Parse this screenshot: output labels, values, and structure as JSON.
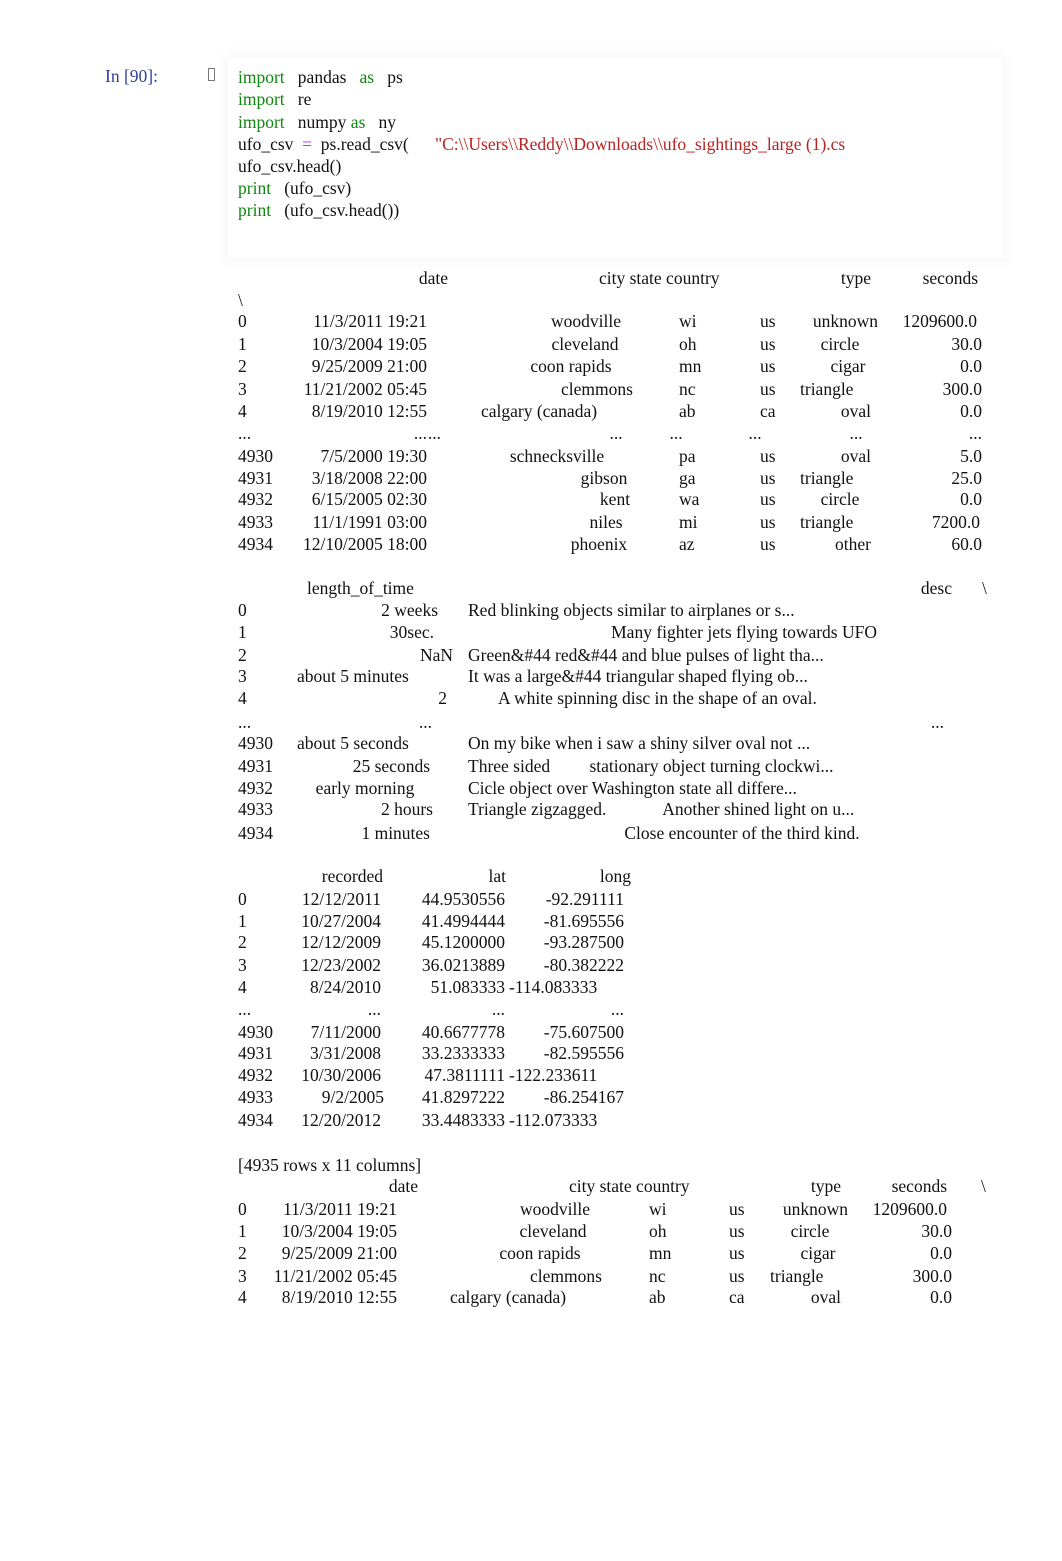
{
  "cell": {
    "prompt": "In [90]:",
    "icon": "cell-collapse-icon",
    "code": [
      [
        {
          "c": "kw",
          "t": "import"
        },
        {
          "c": "",
          "t": "   pandas   "
        },
        {
          "c": "kw",
          "t": "as"
        },
        {
          "c": "",
          "t": "   ps"
        }
      ],
      [
        {
          "c": "kw",
          "t": "import"
        },
        {
          "c": "",
          "t": "   re"
        }
      ],
      [
        {
          "c": "kw",
          "t": "import"
        },
        {
          "c": "",
          "t": "   numpy "
        },
        {
          "c": "kw",
          "t": "as"
        },
        {
          "c": "",
          "t": "   ny"
        }
      ],
      [
        {
          "c": "",
          "t": "ufo_csv  "
        },
        {
          "c": "op",
          "t": "="
        },
        {
          "c": "",
          "t": "  ps.read_csv(      "
        },
        {
          "c": "str",
          "t": "\"C:\\\\Users\\\\Reddy\\\\Downloads\\\\ufo_sightings_large (1).cs"
        }
      ],
      [
        {
          "c": "",
          "t": "ufo_csv.head()"
        }
      ],
      [
        {
          "c": "kw",
          "t": "print"
        },
        {
          "c": "",
          "t": "   (ufo_csv)"
        }
      ],
      [
        {
          "c": "kw",
          "t": "print"
        },
        {
          "c": "",
          "t": "   (ufo_csv.head())"
        }
      ]
    ]
  },
  "output": {
    "block1": {
      "headers": [
        "date",
        "city state country",
        "type",
        "seconds"
      ],
      "continuation": "\\",
      "rows": [
        {
          "idx": "0",
          "date": "11/3/2011 19:21",
          "city": "woodville",
          "state": "wi",
          "country": "us",
          "type": "unknown",
          "seconds": "1209600.0"
        },
        {
          "idx": "1",
          "date": "10/3/2004 19:05",
          "city": "cleveland",
          "state": "oh",
          "country": "us",
          "type": "circle",
          "seconds": "30.0"
        },
        {
          "idx": "2",
          "date": "9/25/2009 21:00",
          "city": "coon rapids",
          "state": "mn",
          "country": "us",
          "type": "cigar",
          "seconds": "0.0"
        },
        {
          "idx": "3",
          "date": "11/21/2002 05:45",
          "city": "clemmons",
          "state": "nc",
          "country": "us",
          "type": "triangle",
          "seconds": "300.0"
        },
        {
          "idx": "4",
          "date": "8/19/2010 12:55",
          "city": "calgary (canada)",
          "state": "ab",
          "country": "ca",
          "type": "oval",
          "seconds": "0.0"
        },
        {
          "idx": "...",
          "date": "...",
          "city": "...",
          "state": "...",
          "country": "...",
          "type": "...",
          "seconds": "..."
        },
        {
          "idx": "4930",
          "date": "7/5/2000 19:30",
          "city": "schnecksville",
          "state": "pa",
          "country": "us",
          "type": "oval",
          "seconds": "5.0"
        },
        {
          "idx": "4931",
          "date": "3/18/2008 22:00",
          "city": "gibson",
          "state": "ga",
          "country": "us",
          "type": "triangle",
          "seconds": "25.0"
        },
        {
          "idx": "4932",
          "date": "6/15/2005 02:30",
          "city": "kent",
          "state": "wa",
          "country": "us",
          "type": "circle",
          "seconds": "0.0"
        },
        {
          "idx": "4933",
          "date": "11/1/1991 03:00",
          "city": "niles",
          "state": "mi",
          "country": "us",
          "type": "triangle",
          "seconds": "7200.0"
        },
        {
          "idx": "4934",
          "date": "12/10/2005 18:00",
          "city": "phoenix",
          "state": "az",
          "country": "us",
          "type": "other",
          "seconds": "60.0"
        }
      ]
    },
    "block2": {
      "headers": [
        "length_of_time",
        "desc"
      ],
      "continuation": "\\",
      "rows": [
        {
          "idx": "0",
          "length": "2 weeks",
          "desc": "Red blinking objects similar to airplanes or s..."
        },
        {
          "idx": "1",
          "length": "30sec.",
          "desc": "Many fighter jets flying towards UFO"
        },
        {
          "idx": "2",
          "length": "NaN",
          "desc": "Green&#44 red&#44 and blue pulses of light tha..."
        },
        {
          "idx": "3",
          "length": "about 5 minutes",
          "desc": "It was a large&#44 triangular shaped flying ob..."
        },
        {
          "idx": "4",
          "length": "2",
          "desc": "A white spinning disc in the shape of an oval."
        },
        {
          "idx": "...",
          "length": "...",
          "desc": "..."
        },
        {
          "idx": "4930",
          "length": "about 5 seconds",
          "desc": "On my bike when i saw a shiny silver oval not ..."
        },
        {
          "idx": "4931",
          "length": "25 seconds",
          "desc": "Three sided         stationary object turning clockwi..."
        },
        {
          "idx": "4932",
          "length": "early morning",
          "desc": "Cicle object over Washington state all differe..."
        },
        {
          "idx": "4933",
          "length": "2 hours",
          "desc": "Triangle zigzagged.             Another shined light on u..."
        },
        {
          "idx": "4934",
          "length": "1 minutes",
          "desc": "Close encounter of the third kind."
        }
      ]
    },
    "block3": {
      "headers": [
        "recorded",
        "lat",
        "long"
      ],
      "rows": [
        {
          "idx": "0",
          "recorded": "12/12/2011",
          "lat": "44.9530556",
          "long": "-92.291111"
        },
        {
          "idx": "1",
          "recorded": "10/27/2004",
          "lat": "41.4994444",
          "long": "-81.695556"
        },
        {
          "idx": "2",
          "recorded": "12/12/2009",
          "lat": "45.1200000",
          "long": "-93.287500"
        },
        {
          "idx": "3",
          "recorded": "12/23/2002",
          "lat": "36.0213889",
          "long": "-80.382222"
        },
        {
          "idx": "4",
          "recorded": "8/24/2010",
          "lat": "51.083333",
          "long": "-114.083333"
        },
        {
          "idx": "...",
          "recorded": "...",
          "lat": "...",
          "long": "..."
        },
        {
          "idx": "4930",
          "recorded": "7/11/2000",
          "lat": "40.6677778",
          "long": "-75.607500"
        },
        {
          "idx": "4931",
          "recorded": "3/31/2008",
          "lat": "33.2333333",
          "long": "-82.595556"
        },
        {
          "idx": "4932",
          "recorded": "10/30/2006",
          "lat": "47.3811111",
          "long": "-122.233611"
        },
        {
          "idx": "4933",
          "recorded": "9/2/2005",
          "lat": "41.8297222",
          "long": "-86.254167"
        },
        {
          "idx": "4934",
          "recorded": "12/20/2012",
          "lat": "33.4483333",
          "long": "-112.073333"
        }
      ]
    },
    "summary": "[4935 rows x 11 columns]",
    "block4": {
      "headers": [
        "date",
        "city state country",
        "type",
        "seconds"
      ],
      "continuation": "\\",
      "rows": [
        {
          "idx": "0",
          "date": "11/3/2011 19:21",
          "city": "woodville",
          "state": "wi",
          "country": "us",
          "type": "unknown",
          "seconds": "1209600.0"
        },
        {
          "idx": "1",
          "date": "10/3/2004 19:05",
          "city": "cleveland",
          "state": "oh",
          "country": "us",
          "type": "circle",
          "seconds": "30.0"
        },
        {
          "idx": "2",
          "date": "9/25/2009 21:00",
          "city": "coon rapids",
          "state": "mn",
          "country": "us",
          "type": "cigar",
          "seconds": "0.0"
        },
        {
          "idx": "3",
          "date": "11/21/2002 05:45",
          "city": "clemmons",
          "state": "nc",
          "country": "us",
          "type": "triangle",
          "seconds": "300.0"
        },
        {
          "idx": "4",
          "date": "8/19/2010 12:55",
          "city": "calgary (canada)",
          "state": "ab",
          "country": "ca",
          "type": "oval",
          "seconds": "0.0"
        }
      ]
    }
  }
}
